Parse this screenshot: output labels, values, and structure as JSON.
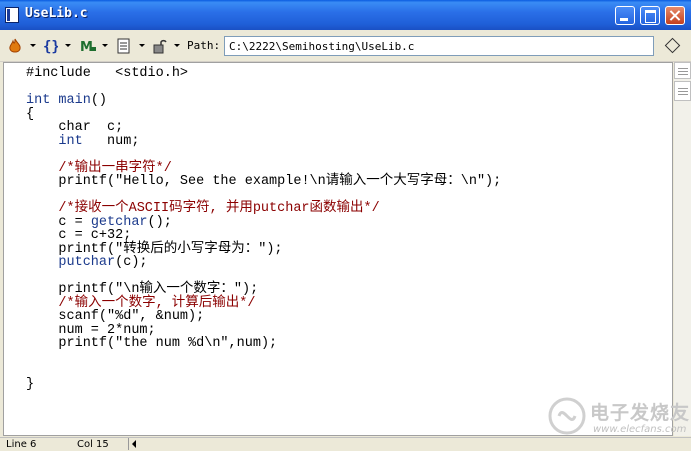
{
  "window": {
    "title": "UseLib.c"
  },
  "toolbar": {
    "path_label": "Path:",
    "path_value": "C:\\2222\\Semihosting\\UseLib.c",
    "buttons": [
      {
        "name": "functions-menu",
        "icon": "flame-icon"
      },
      {
        "name": "braces-menu",
        "icon": "braces-icon"
      },
      {
        "name": "macros-menu",
        "icon": "m-icon"
      },
      {
        "name": "markers-menu",
        "icon": "document-icon"
      },
      {
        "name": "lock-menu",
        "icon": "lock-icon"
      }
    ]
  },
  "editor": {
    "lines": [
      "#include   <stdio.h>",
      "",
      "int main()",
      "{",
      "    char  c;",
      "    int   num;",
      "",
      "    /*输出一串字符*/",
      "    printf(\"Hello, See the example!\\n请输入一个大写字母：\\n\");",
      "",
      "    /*接收一个ASCII码字符, 并用putchar函数输出*/",
      "    c = getchar();",
      "    c = c+32;",
      "    printf(\"转换后的小写字母为：\");",
      "    putchar(c);",
      "",
      "    printf(\"\\n输入一个数字：\");",
      "    /*输入一个数字, 计算后输出*/",
      "    scanf(\"%d\", &num);",
      "    num = 2*num;",
      "    printf(\"the num %d\\n\",num);",
      "",
      "",
      "}"
    ]
  },
  "status": {
    "line": "Line 6",
    "col": "Col 15"
  },
  "watermark": {
    "cn": "电子发烧友",
    "url": "www.elecfans.com"
  },
  "colors": {
    "title_bar": "#2a6fe8",
    "keyword": "#1b3a8c",
    "comment": "#8b0000"
  }
}
